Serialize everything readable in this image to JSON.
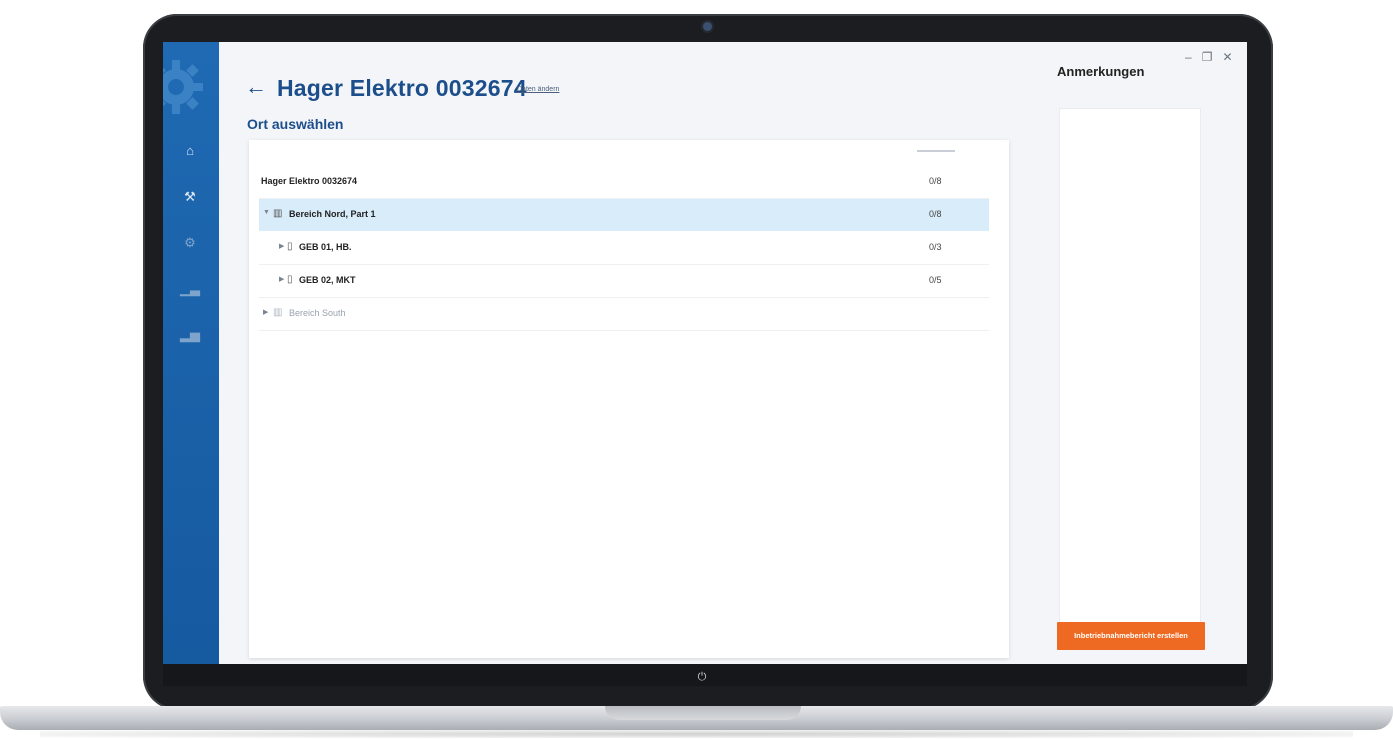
{
  "app": {
    "title": "Hager Elektro 0032674",
    "change_link": "Daten ändern",
    "subtitle": "Ort auswählen"
  },
  "sidebar": {
    "items": [
      {
        "icon": "home-icon"
      },
      {
        "icon": "tools-icon"
      },
      {
        "icon": "settings-icon"
      },
      {
        "icon": "chart-icon"
      },
      {
        "icon": "analytics-icon"
      }
    ]
  },
  "tree": {
    "column_header": "",
    "rows": [
      {
        "label": "Hager Elektro 0032674",
        "count": "0/8",
        "level": 0
      },
      {
        "label": "Bereich Nord, Part 1",
        "count": "0/8",
        "level": 1,
        "expanded": true,
        "selected": true
      },
      {
        "label": "GEB 01, HB.",
        "count": "0/3",
        "level": 2
      },
      {
        "label": "GEB 02, MKT",
        "count": "0/5",
        "level": 2
      },
      {
        "label": "Bereich South",
        "count": "",
        "level": 1,
        "muted": true
      }
    ]
  },
  "panel": {
    "title": "Anmerkungen",
    "hint": "",
    "button": "Inbetriebnahmebericht erstellen"
  },
  "colors": {
    "brand_blue": "#1d4e8c",
    "sidebar_blue": "#1f6ab3",
    "accent_orange": "#ee6a22",
    "selection": "#d9ecf9"
  }
}
